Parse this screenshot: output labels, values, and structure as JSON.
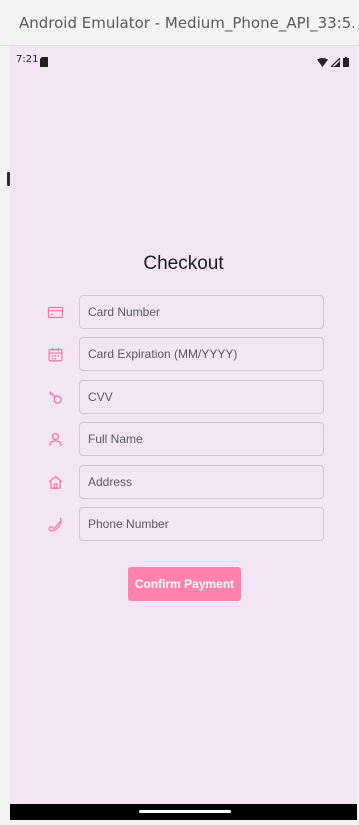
{
  "window": {
    "title": "Android Emulator - Medium_Phone_API_33:5..."
  },
  "status_bar": {
    "time": "7:21"
  },
  "checkout": {
    "title": "Checkout",
    "fields": [
      {
        "icon": "credit-card-icon",
        "placeholder": "Card Number",
        "value": ""
      },
      {
        "icon": "calendar-icon",
        "placeholder": "Card Expiration (MM/YYYY)",
        "value": ""
      },
      {
        "icon": "key-icon",
        "placeholder": "CVV",
        "value": ""
      },
      {
        "icon": "person-icon",
        "placeholder": "Full Name",
        "value": ""
      },
      {
        "icon": "home-icon",
        "placeholder": "Address",
        "value": ""
      },
      {
        "icon": "phone-icon",
        "placeholder": "Phone Number",
        "value": ""
      }
    ],
    "confirm_label": "Confirm Payment"
  },
  "colors": {
    "background": "#f4e5f4",
    "accent": "#ff82ad",
    "field_border": "#d3c3d6"
  }
}
